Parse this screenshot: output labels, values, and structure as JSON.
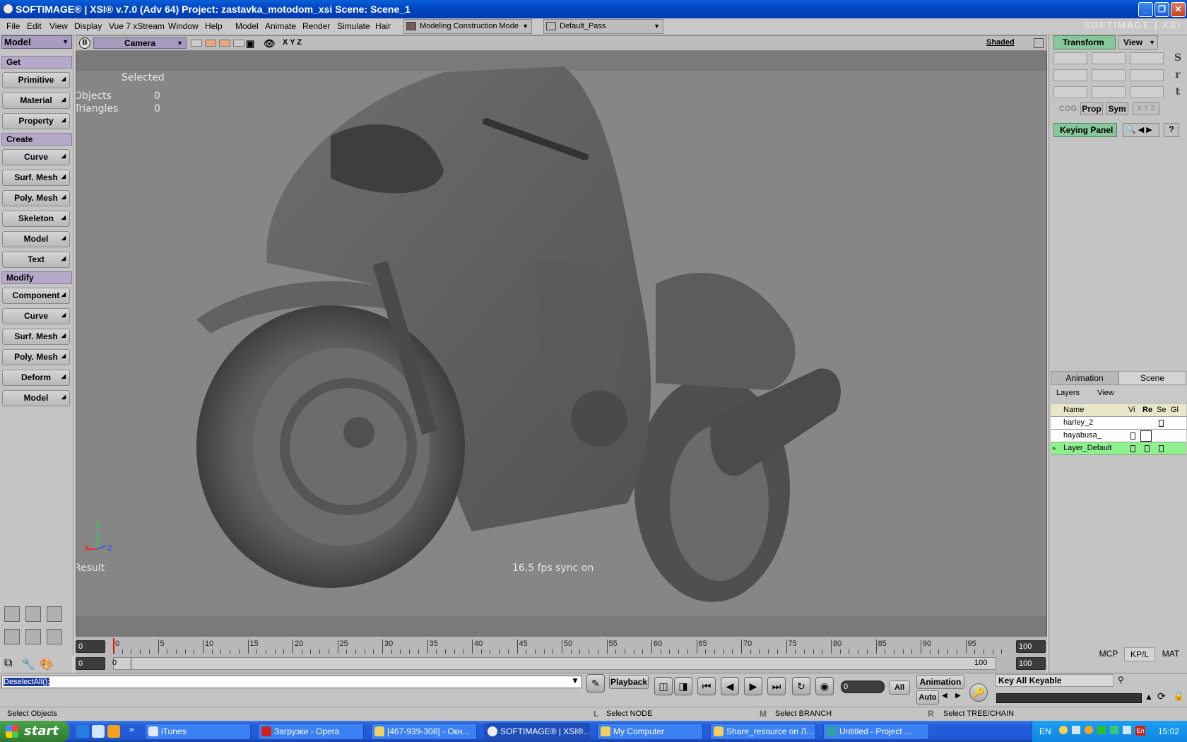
{
  "window": {
    "title": "SOFTIMAGE® | XSI® v.7.0 (Adv 64) Project: zastavka_motodom_xsi    Scene: Scene_1",
    "logo": "SOFTIMAGE | XSI",
    "buttons": [
      "_",
      "❐",
      "✕"
    ]
  },
  "menubar": {
    "items": [
      "File",
      "Edit",
      "View",
      "Display",
      "Vue 7 xStream",
      "Window",
      "Help",
      "Model",
      "Animate",
      "Render",
      "Simulate",
      "Hair"
    ],
    "construction_mode": "Modeling Construction Mode",
    "pass": "Default_Pass"
  },
  "left_toolbar": {
    "mode": "Model",
    "sections": {
      "get": "Get",
      "create": "Create",
      "modify": "Modify"
    },
    "get_buttons": [
      "Primitive",
      "Material",
      "Property"
    ],
    "create_buttons": [
      "Curve",
      "Surf. Mesh",
      "Poly. Mesh",
      "Skeleton",
      "Model",
      "Text"
    ],
    "modify_buttons": [
      "Component",
      "Curve",
      "Surf. Mesh",
      "Poly. Mesh",
      "Deform",
      "Model"
    ]
  },
  "viewport": {
    "b_button": "B",
    "camera": "Camera",
    "axes": "X Y Z",
    "shading": "Shaded",
    "selected_heading": "Selected",
    "objects_label": "Objects",
    "objects_value": "0",
    "triangles_label": "Triangles",
    "triangles_value": "0",
    "result_label": "Result",
    "fps_text": "16.5  fps  sync  on",
    "axis_x": "X",
    "axis_y": "Y",
    "axis_z": "Z"
  },
  "timeline": {
    "start": "0",
    "end": "100",
    "range_start": "0",
    "range_start2": "0",
    "range_end": "100",
    "range_end2": "100",
    "ticks": [
      "0",
      "5",
      "10",
      "15",
      "20",
      "25",
      "30",
      "35",
      "40",
      "45",
      "50",
      "55",
      "60",
      "65",
      "70",
      "75",
      "80",
      "85",
      "90",
      "95"
    ],
    "current_frame": 0
  },
  "command": {
    "input_value": "DeselectAll();",
    "playback_label": "Playback",
    "frame_value": "0",
    "all_label": "All",
    "animation_label": "Animation",
    "auto_label": "Auto",
    "key_all": "Key All Keyable"
  },
  "status": {
    "left": "Select Objects",
    "l_key": "L",
    "l_text": "Select NODE",
    "m_key": "M",
    "m_text": "Select BRANCH",
    "r_key": "R",
    "r_text": "Select TREE/CHAIN"
  },
  "right_panel": {
    "transform_tab": "Transform",
    "view_tab": "View",
    "srt": [
      "S",
      "r",
      "t"
    ],
    "cog": "COG",
    "prop": "Prop",
    "sym": "Sym",
    "xyz": "X Y Z",
    "keying_panel": "Keying Panel",
    "help": "?",
    "tabs": [
      "Animation",
      "Scene"
    ],
    "layer_menus": [
      "Layers",
      "View"
    ],
    "layer_columns": [
      "Name",
      "Vi",
      "Re",
      "Se",
      "Gl"
    ],
    "layers": [
      {
        "name": "harley_2"
      },
      {
        "name": "hayabusa_"
      },
      {
        "name": "Layer_Default"
      }
    ],
    "bottom_tabs": [
      "MCP",
      "KP/L",
      "MAT"
    ]
  },
  "taskbar": {
    "start_label": "start",
    "tasks": [
      "iTunes",
      "Загрузки - Opera",
      "[467-939-308] - Окн...",
      "SOFTIMAGE® | XSI®...",
      "My Computer",
      "Share_resource on Л...",
      "Untitled      - Project ..."
    ],
    "language": "EN",
    "clock": "15:02"
  }
}
